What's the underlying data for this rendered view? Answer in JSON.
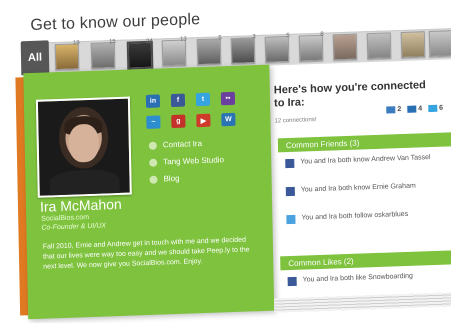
{
  "header": {
    "title": "Get to know our people"
  },
  "tabs": {
    "all_label": "All",
    "thumbs": [
      {
        "count": "19"
      },
      {
        "count": "15"
      },
      {
        "count": "24"
      },
      {
        "count": "13"
      },
      {
        "count": "5"
      },
      {
        "count": "3"
      },
      {
        "count": "5"
      },
      {
        "count": "8"
      },
      {
        "count": ""
      },
      {
        "count": ""
      },
      {
        "count": ""
      },
      {
        "count": ""
      }
    ]
  },
  "profile": {
    "name": "Ira McMahon",
    "site": "SocialBios.com",
    "role": "Co-Founder & UI/UX",
    "links": [
      "Contact Ira",
      "Tang Web Studio",
      "Blog"
    ],
    "bio": "Fall 2010, Ernie and Andrew get in touch with me and we decided that our lives were way too easy and we should take Peep.ly to the next level. We now give you SocialBios.com. Enjoy."
  },
  "social_icons": [
    {
      "label": "in",
      "color": "#2a6fb3"
    },
    {
      "label": "f",
      "color": "#3b5998"
    },
    {
      "label": "t",
      "color": "#35a4e0"
    },
    {
      "label": "••",
      "color": "#6a3fa0"
    },
    {
      "label": "~",
      "color": "#2c8ecf"
    },
    {
      "label": "g",
      "color": "#c4322a"
    },
    {
      "label": "▶",
      "color": "#d03a2a"
    },
    {
      "label": "W",
      "color": "#2a74b5"
    }
  ],
  "connections": {
    "title_line1": "Here's how you're connected",
    "title_line2": "to Ira:",
    "count_text": "12 connections!",
    "badges": [
      "2",
      "4",
      "6"
    ],
    "common_friends_header": "Common Friends (3)",
    "friends": [
      {
        "text": "You and Ira both know Andrew Van Tassel",
        "type": "fb"
      },
      {
        "text": "You and Ira both know Ernie Graham",
        "type": "fb"
      },
      {
        "text": "You and Ira both follow oskarblues",
        "type": "tw"
      }
    ],
    "common_likes_header": "Common Likes (2)",
    "likes": [
      {
        "text": "You and Ira both like Snowboarding",
        "type": "fb"
      }
    ]
  }
}
